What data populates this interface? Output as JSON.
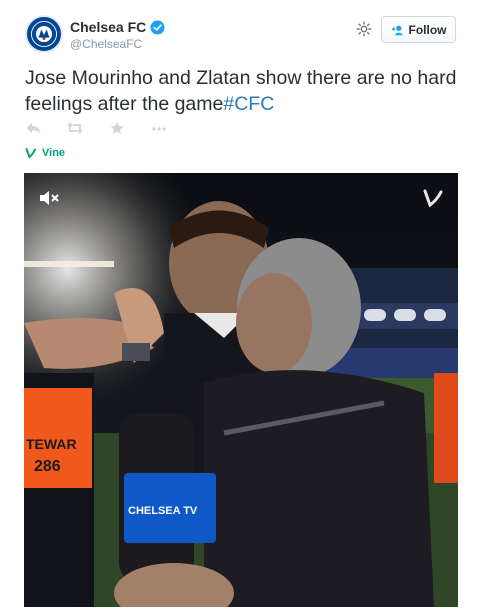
{
  "account": {
    "name": "Chelsea FC",
    "handle": "@ChelseaFC",
    "verified": true
  },
  "follow_label": "Follow",
  "tweet": {
    "text": "Jose Mourinho and Zlatan show there are no hard feelings after the game",
    "hashtag": "#CFC"
  },
  "actions": [
    "reply-icon",
    "retweet-icon",
    "favorite-icon",
    "more-icon"
  ],
  "card": {
    "source": "Vine"
  },
  "video": {
    "bib_text": "TEWAR",
    "bib_number": "286",
    "microphone_label": "CHELSEA TV"
  },
  "colors": {
    "brand_blue": "#034694",
    "link": "#2b7bb9",
    "vine_green": "#00a478",
    "muted": "#8899a6"
  }
}
